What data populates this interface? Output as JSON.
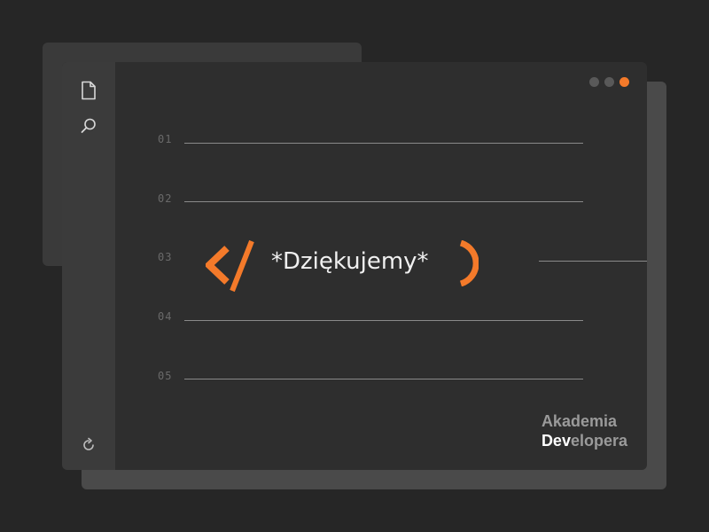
{
  "window": {
    "controls": [
      {
        "name": "dot-1",
        "color": "#595959"
      },
      {
        "name": "dot-2",
        "color": "#595959"
      },
      {
        "name": "dot-3",
        "color": "#f47a2a"
      }
    ]
  },
  "sidebar": {
    "icons": [
      "file-icon",
      "search-icon",
      "refresh-icon"
    ]
  },
  "editor": {
    "line_numbers": [
      "01",
      "02",
      "03",
      "04",
      "05"
    ],
    "main_text": "*Dziękujemy*",
    "accent_color": "#f47a2a"
  },
  "brand": {
    "line1": "Akademia",
    "line2_bold": "Dev",
    "line2_rest": "elopera"
  }
}
